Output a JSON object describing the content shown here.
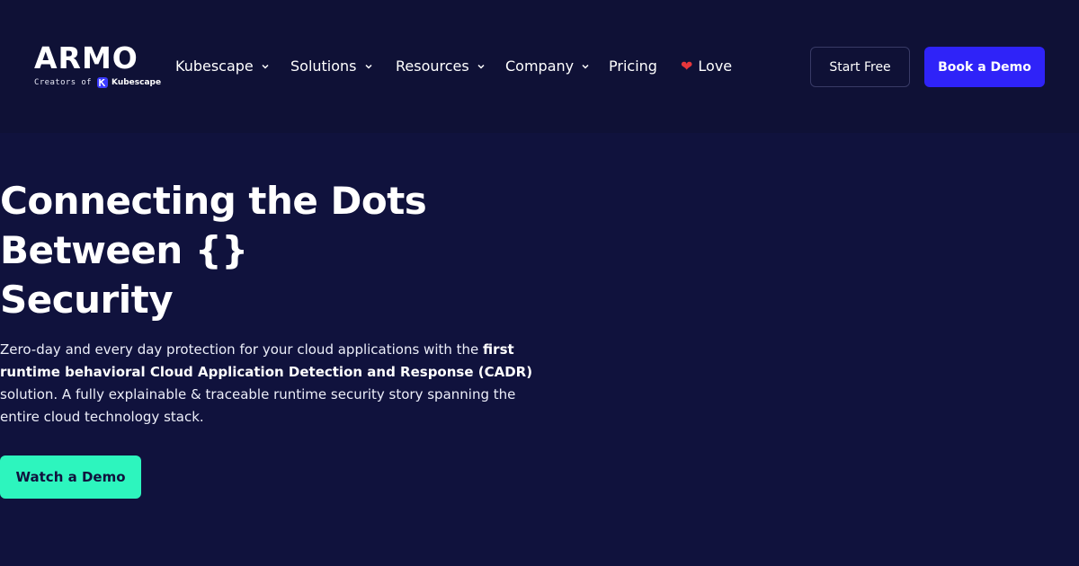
{
  "logo": {
    "wordmark": "ARMO",
    "creators_of": "Creators of",
    "kubescape": "Kubescape"
  },
  "nav": {
    "items": [
      {
        "label": "Kubescape",
        "dropdown": true
      },
      {
        "label": "Solutions",
        "dropdown": true
      },
      {
        "label": "Resources",
        "dropdown": true
      },
      {
        "label": "Company",
        "dropdown": true
      },
      {
        "label": "Pricing",
        "dropdown": false
      },
      {
        "label": "Love",
        "dropdown": false,
        "icon": "heart-icon"
      }
    ]
  },
  "header_buttons": {
    "start_free": "Start Free",
    "book_demo": "Book a Demo"
  },
  "hero": {
    "title_lines": [
      "Connecting the Dots",
      "Between {}",
      "Security"
    ],
    "desc_part1": "Zero-day and every day protection for your cloud applications with the ",
    "desc_bold": "first runtime behavioral Cloud Application Detection and Response (CADR)",
    "desc_part2": " solution. A fully explainable & traceable runtime security story spanning the entire cloud technology stack.",
    "cta": "Watch a Demo"
  },
  "colors": {
    "background": "#10123d",
    "header_bg": "#0f1136",
    "primary_button": "#2f23f8",
    "cta_button": "#2df5be",
    "heart": "#e6363b"
  }
}
